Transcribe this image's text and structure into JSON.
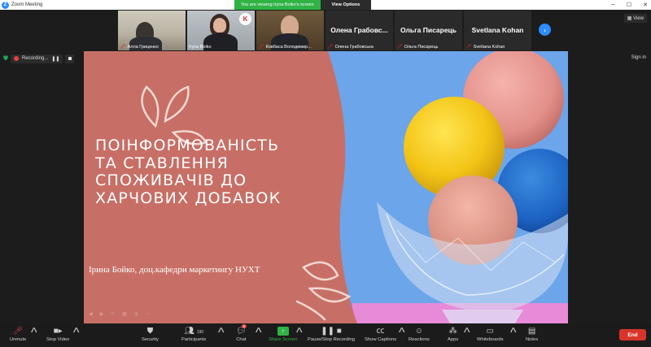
{
  "window": {
    "title": "Zoom Meeting",
    "share_message": "You are viewing Iryna Boiko's screen",
    "view_options": "View Options",
    "view_button": "View",
    "sign_in": "Sign in"
  },
  "recording": {
    "label": "Recording..."
  },
  "participants": [
    {
      "name": "Алла Гриценко",
      "muted": true,
      "video": true
    },
    {
      "name": "Iryna Boiko",
      "muted": false,
      "video": true
    },
    {
      "name": "Ковбаса Володимир...",
      "muted": true,
      "video": true
    },
    {
      "name": "Олена Грабовська",
      "display": "Олена  Грабовс...",
      "muted": true,
      "video": false
    },
    {
      "name": "Ольга Писарець",
      "display": "Ольга Писарець",
      "muted": true,
      "video": false
    },
    {
      "name": "Svetlana Kohan",
      "display": "Svetlana Kohan",
      "muted": true,
      "video": false
    }
  ],
  "slide": {
    "headline_lines": [
      "Поінформованість",
      "та ставлення",
      "споживачів до",
      "харчових добавок"
    ],
    "author": "Ірина Бойко, доц.кафедри маркетингу НУХТ"
  },
  "toolbar": {
    "unmute": "Unmute",
    "stop_video": "Stop Video",
    "security": "Security",
    "participants": "Participants",
    "participants_count": "190",
    "chat": "Chat",
    "chat_badge": "6",
    "share_screen": "Share Screen",
    "record": "Pause/Stop Recording",
    "captions": "Show Captions",
    "reactions": "Reactions",
    "apps": "Apps",
    "whiteboards": "Whiteboards",
    "notes": "Notes",
    "end": "End"
  },
  "colors": {
    "zoom_blue": "#2d8cff",
    "share_green": "#2fb344",
    "end_red": "#d9342b",
    "slide_panel": "#c76f66"
  }
}
